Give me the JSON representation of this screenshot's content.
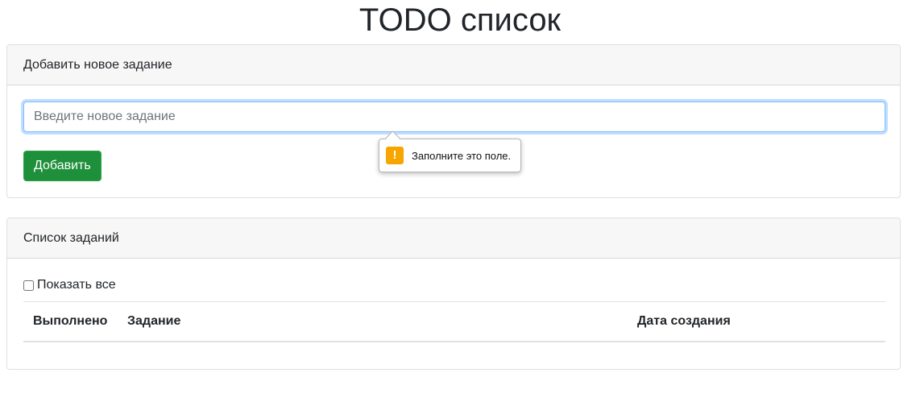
{
  "page": {
    "title": "TODO список"
  },
  "add_card": {
    "header": "Добавить новое задание",
    "input_placeholder": "Введите новое задание",
    "input_value": "",
    "add_button_label": "Добавить",
    "validation_tooltip": {
      "icon": "warning-icon",
      "icon_glyph": "!",
      "text": "Заполните это поле."
    }
  },
  "list_card": {
    "header": "Список заданий",
    "show_all_label": "Показать все",
    "show_all_checked": false,
    "table": {
      "columns": [
        "Выполнено",
        "Задание",
        "Дата создания"
      ],
      "rows": []
    }
  },
  "colors": {
    "accent": "#80bdff",
    "success": "#28a745",
    "warning": "#f7a600"
  }
}
